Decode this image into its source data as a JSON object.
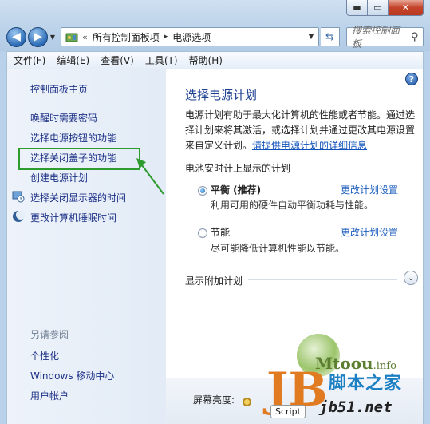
{
  "window": {
    "min_glyph": "▬",
    "max_glyph": "▭",
    "close_glyph": "✕"
  },
  "address": {
    "chevrons": "«",
    "crumbs": [
      "所有控制面板项",
      "电源选项"
    ],
    "separator": "▸"
  },
  "search": {
    "placeholder": "搜索控制面板"
  },
  "menu": [
    "文件(F)",
    "编辑(E)",
    "查看(V)",
    "工具(T)",
    "帮助(H)"
  ],
  "left": {
    "home": "控制面板主页",
    "links": [
      "唤醒时需要密码",
      "选择电源按钮的功能",
      "选择关闭盖子的功能",
      "创建电源计划",
      "选择关闭显示器的时间",
      "更改计算机睡眠时间"
    ],
    "see_also": "另请参阅",
    "see_also_links": [
      "个性化",
      "Windows 移动中心",
      "用户帐户"
    ]
  },
  "right": {
    "title": "选择电源计划",
    "desc": "电源计划有助于最大化计算机的性能或者节能。通过选择计划来将其激活，或选择计划并通过更改其电源设置来自定义计划。",
    "desc_link": "请提供电源计划的详细信息",
    "group_title": "电池安时计上显示的计划",
    "plans": [
      {
        "name": "平衡 (推荐)",
        "desc": "利用可用的硬件自动平衡功耗与性能。",
        "link": "更改计划设置",
        "selected": true
      },
      {
        "name": "节能",
        "desc": "尽可能降低计算机性能以节能。",
        "link": "更改计划设置",
        "selected": false
      }
    ],
    "extra": "显示附加计划",
    "brightness_label": "屏幕亮度:"
  },
  "watermark": {
    "site": "Mtoou",
    "site_suffix": ".info",
    "cn": "脚本之家",
    "logo": "JB",
    "domain": "jb51.net",
    "script_badge": "Script"
  },
  "colors": {
    "highlight_box": "#2d9b2d",
    "link": "#1e3287",
    "title": "#1b3f91"
  }
}
